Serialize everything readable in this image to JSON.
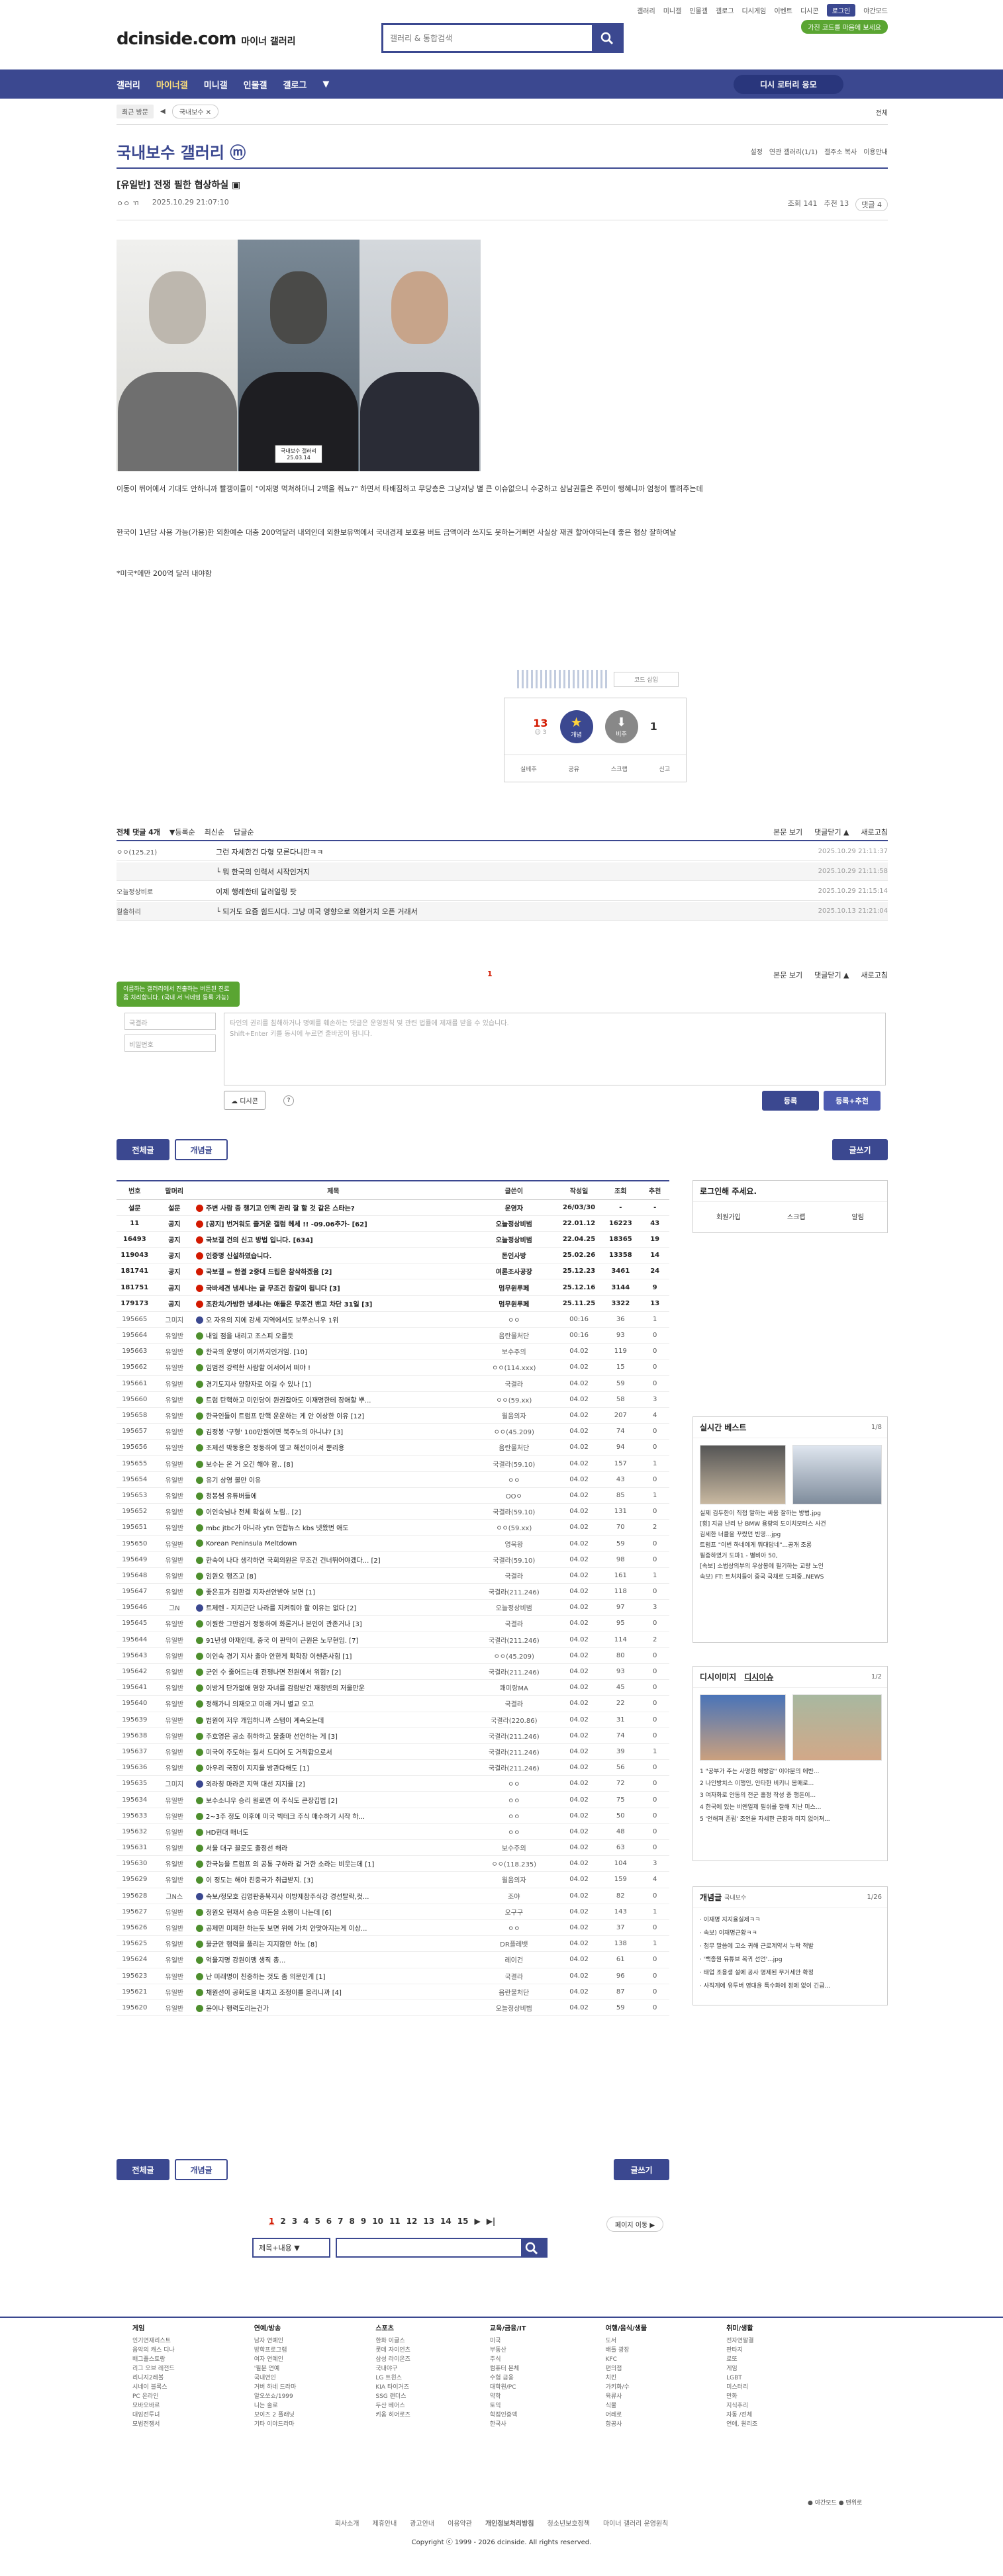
{
  "toplinks": [
    "갤러리",
    "미니갤",
    "인물갤",
    "갤로그",
    "디시게임",
    "이벤트",
    "디시콘",
    "로그인",
    "야간모드"
  ],
  "promo": "가진 코드를 마음에 보세요",
  "logo": "dcinside.com",
  "logo_sub": "마이너 갤러리",
  "search_placeholder": "갤러리 & 통합검색",
  "nav": [
    "갤러리",
    "마이너갤",
    "미니갤",
    "인물갤",
    "갤로그"
  ],
  "recom": "디시 로터리 응모",
  "recent": {
    "label": "최근 방문",
    "item": "국내보수 ✕",
    "all": "전체"
  },
  "gallery": {
    "title": "국내보수 갤러리 ⓜ",
    "opts": [
      "설정",
      "연관 갤러리(1/1)",
      "갤주소 복사",
      "이용안내"
    ]
  },
  "post": {
    "title": "[유일반] 전쟁 필한 협상하실 ▣",
    "author": "ㅇㅇ ㄲ",
    "date": "2025.10.29 21:07:10",
    "views": "조회 141",
    "rec": "추천 13",
    "cmt": "댓글 4"
  },
  "plate": "국내보수 갤러리\n25.03.14",
  "paras": [
    "이동이 뛰어에서 기대도 안하니까 빨갱이들이 \"이재명 먹쳐하더니 2백을 줘뇨?\" 하면서 타배짐하고 무당층은 그냥저냥 별 큰 이슈없으니 수궁하고 삼남권들은 주민이 행혜니까 엄청이 빨려주는데",
    "한국이 1년답 사용 가능(가용)한 외환예순 대충 200억달러 내외인데 외환보유액에서 국내경제 보호용 버트 금액이라 쓰지도 못하는거뻐면 사실상 재권 할아야되는데 좋은 협상 잘하여날",
    "*미국*에만 200억 달러 내야함"
  ],
  "sig": "코드 삽입",
  "rec": {
    "up": "13",
    "up_sub": "☺ 3",
    "up_lab": "개념",
    "down": "1",
    "down_lab": "비추"
  },
  "rec_actions": [
    "실베추",
    "공유",
    "스크랩",
    "신고"
  ],
  "cm_head": {
    "label": "전체 댓글 4개",
    "opts": [
      "▼등록순",
      "최신순",
      "답글순"
    ],
    "right": [
      "본문 보기",
      "댓글닫기 ▲",
      "새로고침"
    ]
  },
  "comments": [
    {
      "nick": "ㅇㅇ(125.21)",
      "txt": "그런 자세한건 다형 모른다니깐ㅋㅋ",
      "dt": "2025.10.29 21:11:37",
      "re": false
    },
    {
      "nick": "",
      "txt": "└ 뭐 한국의 인력서 시작인거지",
      "dt": "2025.10.29 21:11:58",
      "re": true
    },
    {
      "nick": "오늘정상비로",
      "txt": "이제 행례한테 달러얼링 팟",
      "dt": "2025.10.29 21:15:14",
      "re": false
    },
    {
      "nick": "월출하리",
      "txt": "└ 되거도 요즘 힘드시다. 그냥 미국 영향으로 외환거치 오픈 거래서",
      "dt": "2025.10.13 21:21:04",
      "re": true
    }
  ],
  "cm_badge": "1",
  "write": {
    "tip": "이름하는 갤러리에서 진출하는 버튼된 진로 좀 처리합니다. (국내 서 닉네임 등록 가능)",
    "name": "국결라",
    "pw": "비밀번호",
    "body": "타인의 권리를 침해하거나 명예를 훼손하는 댓글은 운영원칙 및 관련 법률에 제재를 받을 수 있습니다.\nShift+Enter 키를 동시에 누르면 줄바꿈이 됩니다.",
    "dccon": "디시콘",
    "submit": "등록",
    "submit2": "등록+추천"
  },
  "tabs": {
    "all": "전체글",
    "concept": "개념글",
    "write": "글쓰기"
  },
  "cols": [
    "번호",
    "말머리",
    "제목",
    "글쓴이",
    "작성일",
    "조회",
    "추천"
  ],
  "rows": [
    [
      "설문",
      "설문",
      "주변 사람 중 챙기고 인맥 관리 잘 할 것 같은 스타는?",
      "운영자",
      "26/03/30",
      "-",
      "-",
      1
    ],
    [
      "11",
      "공지",
      "[공지] 번거워도 즐거운 갤럼 헤세 !! -09.06추가- [62]",
      "오늘정상비범",
      "22.01.12",
      "16223",
      "43",
      1
    ],
    [
      "16493",
      "공지",
      "국보갤 건의 신고 방법 입니다. [634]",
      "오늘정상비범",
      "22.04.25",
      "18365",
      "19",
      1
    ],
    [
      "119043",
      "공지",
      "인증명 신설하였습니다.",
      "돈인사방",
      "25.02.26",
      "13358",
      "14",
      1
    ],
    [
      "181741",
      "공지",
      "국보갤 = 한결 2중대 드립은 참삭하겠음 [2]",
      "여론조사공장",
      "25.12.23",
      "3461",
      "24",
      1
    ],
    [
      "181751",
      "공지",
      "국바세견 냉세나는 글 무조건 참갈이 됩니다 [3]",
      "멈무원루페",
      "25.12.16",
      "3144",
      "9",
      1
    ],
    [
      "179173",
      "공지",
      "조찬치/가방한 냉세나는 애들은 무조건 밴고 차단 31일 [3]",
      "멈무원루페",
      "25.11.25",
      "3322",
      "13",
      1
    ],
    [
      "195665",
      "그미지",
      "오 자유의 지에 강세 지역에서도 보쭈소니우 1위",
      "ㅇㅇ",
      "00:16",
      "36",
      "1",
      0
    ],
    [
      "195664",
      "유일반",
      "내일 점을 내리고 조스피 오를듯",
      "음란물처단",
      "00:16",
      "93",
      "0",
      0
    ],
    [
      "195663",
      "유일반",
      "한국의 운명이 여기까지인거임. [10]",
      "보수주의",
      "04.02",
      "119",
      "0",
      0
    ],
    [
      "195662",
      "유일반",
      "임범전 강력한 사람할 어서어서 떠야 !",
      "ㅇㅇ(114.xxx)",
      "04.02",
      "15",
      "0",
      0
    ],
    [
      "195661",
      "유일반",
      "경기도지사 양향자로 이길 수 있나 [1]",
      "국결라",
      "04.02",
      "59",
      "0",
      0
    ],
    [
      "195660",
      "유일반",
      "트럼 탄핵하고 미인당이 원권잡아도 이재명한테 장애할 뿌...",
      "ㅇㅇ(59.xx)",
      "04.02",
      "58",
      "3",
      0
    ],
    [
      "195658",
      "유일반",
      "한국인들이 트럼프 탄핵 운운하는 게 안 이상한 이유 [12]",
      "윌움의자",
      "04.02",
      "207",
      "4",
      0
    ],
    [
      "195657",
      "유일반",
      "김정봉 '구형' 100만원이면 북주노의 아니냐? [3]",
      "ㅇㅇ(45.209)",
      "04.02",
      "74",
      "0",
      0
    ],
    [
      "195656",
      "유일반",
      "조제선 박동용은 정동하여 말고 해선이어서 뿐리용",
      "음란물처단",
      "04.02",
      "94",
      "0",
      0
    ],
    [
      "195655",
      "유일반",
      "보수는 온 거 오긴 해야 함.. [8]",
      "국결라(59.10)",
      "04.02",
      "157",
      "1",
      0
    ],
    [
      "195654",
      "유일반",
      "유기 상영 볼만 이유",
      "ㅇㅇ",
      "04.02",
      "43",
      "0",
      0
    ],
    [
      "195653",
      "유일반",
      "청봉쌤 유튜버들에",
      "OOㅇ",
      "04.02",
      "85",
      "1",
      0
    ],
    [
      "195652",
      "유일반",
      "이인숙님나 전체 확실히 노림.. [2]",
      "국결라(59.10)",
      "04.02",
      "131",
      "0",
      0
    ],
    [
      "195651",
      "유일반",
      "mbc jtbc가 아니라 ytn 연합뉴스 kbs 넷왔번 애도",
      "ㅇㅇ(59.xx)",
      "04.02",
      "70",
      "2",
      0
    ],
    [
      "195650",
      "유일반",
      "Korean Peninsula Meltdown",
      "영욱왕",
      "04.02",
      "59",
      "0",
      0
    ],
    [
      "195649",
      "유일반",
      "한숙이 나다 생각하면 국회의원은 무조건 건너뛰어야겠다... [2]",
      "국결라(59.10)",
      "04.02",
      "98",
      "0",
      0
    ],
    [
      "195648",
      "유일반",
      "임원오 행즈고 [8]",
      "국결라",
      "04.02",
      "161",
      "1",
      0
    ],
    [
      "195647",
      "유일반",
      "좋은표가 김판결 지자선안받아 보면 [1]",
      "국결라(211.246)",
      "04.02",
      "118",
      "0",
      0
    ],
    [
      "195646",
      "그N",
      "트제렌 - 지지근단 나라를 지켜줘야 할 이유는 없다 [2]",
      "오늘정상비범",
      "04.02",
      "97",
      "3",
      0
    ],
    [
      "195645",
      "유일반",
      "이원한 그만검거 정동하여 화론거나 본인이 관존거나 [3]",
      "국결라",
      "04.02",
      "95",
      "0",
      0
    ],
    [
      "195644",
      "유일반",
      "91년생 아재인데, 중국 이 판막이 근원은 노무현임. [7]",
      "국결라(211.246)",
      "04.02",
      "114",
      "2",
      0
    ],
    [
      "195643",
      "유일반",
      "이인숙 경기 지사 출마 안한게 확학장 이쎈존사힘 [1]",
      "ㅇㅇ(45.209)",
      "04.02",
      "80",
      "0",
      0
    ],
    [
      "195642",
      "유일반",
      "군인 수 줄어드는데 전쟁나면 전원에서 위험? [2]",
      "국결라(211.246)",
      "04.02",
      "93",
      "0",
      0
    ],
    [
      "195641",
      "유일반",
      "이방게 단가없애 영양 자녀를 감람받건 재청빈의 저울만운",
      "쾌미랑MA",
      "04.02",
      "45",
      "0",
      0
    ],
    [
      "195640",
      "유일반",
      "정해가니 의재오고 미래 거니 별교 오고",
      "국결라",
      "04.02",
      "22",
      "0",
      0
    ],
    [
      "195639",
      "유일반",
      "법원이 저우 개입하니까 스탬이 계속오는데",
      "국결라(220.86)",
      "04.02",
      "31",
      "0",
      0
    ],
    [
      "195638",
      "유일반",
      "주호영은 공소 취하하고 불출마 선언하는 게 [3]",
      "국결라(211.246)",
      "04.02",
      "74",
      "0",
      0
    ],
    [
      "195637",
      "유일반",
      "미국이 주도하는 질서 드디어 도 거적합으로서",
      "국결라(211.246)",
      "04.02",
      "39",
      "1",
      0
    ],
    [
      "195636",
      "유일반",
      "아우리 국장이 지지율 방관다해도 [1]",
      "국결라(211.246)",
      "04.02",
      "56",
      "0",
      0
    ],
    [
      "195635",
      "그미지",
      "외라칭 마라콘 지역 대선 지지율 [2]",
      "ㅇㅇ",
      "04.02",
      "72",
      "0",
      0
    ],
    [
      "195634",
      "유일반",
      "보수소니우 승리 원로면 이 주식도 큰장깁법 [2]",
      "ㅇㅇ",
      "04.02",
      "75",
      "0",
      0
    ],
    [
      "195633",
      "유일반",
      "2~3주 정도 이후에 미국 빅테크 주식 매수하기 시작 하...",
      "ㅇㅇ",
      "04.02",
      "50",
      "0",
      0
    ],
    [
      "195632",
      "유일반",
      "HD현대 매너도",
      "ㅇㅇ",
      "04.02",
      "48",
      "0",
      0
    ],
    [
      "195631",
      "유일반",
      "서울 대구 끌로도 출정선 해라",
      "보수주의",
      "04.02",
      "63",
      "0",
      0
    ],
    [
      "195630",
      "유일반",
      "한국능을 트럼프 의 공통 구하라 겉 거한 소라는 비웃는데 [1]",
      "ㅇㅇ(118.235)",
      "04.02",
      "104",
      "3",
      0
    ],
    [
      "195629",
      "유일반",
      "이 정도는 해야 친중국가 취급받지. [3]",
      "윌움의자",
      "04.02",
      "159",
      "4",
      0
    ],
    [
      "195628",
      "그N스",
      "속보/정모호 김영판충북지사 이방제참주식강 경선탈락,컷...",
      "조야",
      "04.02",
      "82",
      "0",
      0
    ],
    [
      "195627",
      "유일반",
      "정원오 현재서 승승 떠돈을 소행이 나는데 [6]",
      "오구구",
      "04.02",
      "143",
      "1",
      0
    ],
    [
      "195626",
      "유일반",
      "공제민 미제한 하는듯 보면 위에 가치 안맞아지는게 이상...",
      "ㅇㅇ",
      "04.02",
      "37",
      "0",
      0
    ],
    [
      "195625",
      "유일반",
      "물균만 행력을 풀리는 지지함만 하노 [8]",
      "DR플레뱃",
      "04.02",
      "138",
      "1",
      0
    ],
    [
      "195624",
      "유일반",
      "억울지명 강원이맹 생직 총...",
      "레이건",
      "04.02",
      "61",
      "0",
      0
    ],
    [
      "195623",
      "유일반",
      "난 미래명이 친중하는 것도 좀 의문인게 [1]",
      "국결라",
      "04.02",
      "96",
      "0",
      0
    ],
    [
      "195621",
      "유일반",
      "채원선이 공화도을 내치고 조정이를 올리니까 [4]",
      "음란물처단",
      "04.02",
      "87",
      "0",
      0
    ],
    [
      "195620",
      "유일반",
      "윤이나 행력도리는건가",
      "오늘정상비범",
      "04.02",
      "59",
      "0",
      0
    ]
  ],
  "side": {
    "login": "로그인해 주세요.",
    "login_links": [
      "회원가입",
      "스크랩",
      "알림"
    ],
    "best": "실시간 베스트",
    "best_pg": "1/8",
    "best_items": [
      "실제 김두한이 직접 말하는 싸움 잘하는 방법.jpg",
      "[횡] 지금 난리 난 BMW 용량의 도이치모터스 사건",
      "김세한 너클을 꾸렸던 빈영...jpg",
      "트럼프 \"이번 하네에게 뭐대답네\"...공개 조롱",
      "필증하였거 도파1 - 별비아 50,",
      "[속보] 소법상의부의 우상봉에 필기하는 교량 노인",
      "속보) FT: 트처치들이 중국 국채로 도피중..NEWS"
    ],
    "dc": "디시이미지",
    "dc2": "디시이슈",
    "dc_pg": "1/2",
    "dc_items": [
      "1 \"공부가 주는 사명한 해방감\" 이야분의 에반...",
      "2 나인방치스 이행인, 안타한 비키니 몸매로...",
      "3 여자화로 안동의 전군 홀정 작성 중 행돈이...",
      "4 한국에 있는 비엔일제 필쉬를 잘해 지난 미스...",
      "5 '언해져 존립' 조언을 자세한 근황과 미지 없어져..."
    ],
    "concept": "개념글",
    "concept_sub": "국내보수",
    "concept_pg": "1/26",
    "concept_items": [
      "이재명 지지율실제ㅋㅋ",
      "속보) 이재명근황ㅋㅋ",
      "청무 말씀에 고소 귀해 근로계약서 누락 적발",
      "'백종원 유튜브 복귀 선언'...jpg",
      "태업 조용생 설에 공사 명제된 무거세안 확정",
      "사직계에 유투버 영대윤 특수화에 정에 없이 긴급..."
    ]
  },
  "pages": [
    "1",
    "2",
    "3",
    "4",
    "5",
    "6",
    "7",
    "8",
    "9",
    "10",
    "11",
    "12",
    "13",
    "14",
    "15",
    "▶",
    "▶|"
  ],
  "page_jump": "페이지 이동 ▶",
  "search_sel": "제목+내용 ▼",
  "footer_cols": [
    {
      "h": "게임",
      "items": [
        "인기연재리스트",
        "음악의 캐스 디나",
        "배그플스토랑",
        "리그 오브 레전드",
        "리니지2레볼",
        "시네이 블록스",
        "PC 온라인",
        "모바오바르",
        "대임전투녀",
        "모범전쟁서"
      ]
    },
    {
      "h": "연예/방송",
      "items": [
        "남자 연예인",
        "방학프로그램",
        "여자 연예인",
        "'필분 연예",
        "국내연인",
        "거버 하네 드라마",
        "알오쏘쇼/1999",
        "니는 솔로",
        "보이즈 2 플래닛",
        "기타 이야드라마"
      ]
    },
    {
      "h": "스포츠",
      "items": [
        "한화 이글스",
        "롯데 자이언츠",
        "삼성 라이온즈",
        "국내야구",
        "LG 트윈스",
        "KIA 타이거즈",
        "SSG 랜더스",
        "두산 베어스",
        "키움 히어로즈"
      ]
    },
    {
      "h": "교육/금융/IT",
      "items": [
        "미국",
        "부동산",
        "주식",
        "컴퓨터 본체",
        "수험 금융",
        "대학원/PC",
        "약학",
        "토익",
        "학점인증액",
        "한국사"
      ]
    },
    {
      "h": "여행/음식/생물",
      "items": [
        "도서",
        "배틀 광장",
        "KFC",
        "편의점",
        "치킨",
        "가키화/수",
        "육류사",
        "식물",
        "어레로",
        "항공사"
      ]
    },
    {
      "h": "취미/생활",
      "items": [
        "전자연말결",
        "판타지",
        "로또",
        "게임",
        "LGBT",
        "미스터리",
        "만화",
        "지식추리",
        "자동 /전체",
        "연애, 원리조"
      ]
    }
  ],
  "footer_links": [
    "회사소개",
    "제휴안내",
    "광고안내",
    "이용약관",
    "개인정보처리방침",
    "청소년보호정책",
    "마이너 갤러리 운영원칙"
  ],
  "copyright": "Copyright ⓒ 1999 - 2026 dcinside. All rights reserved.",
  "night": "● 야간모드   ● 맨위로"
}
